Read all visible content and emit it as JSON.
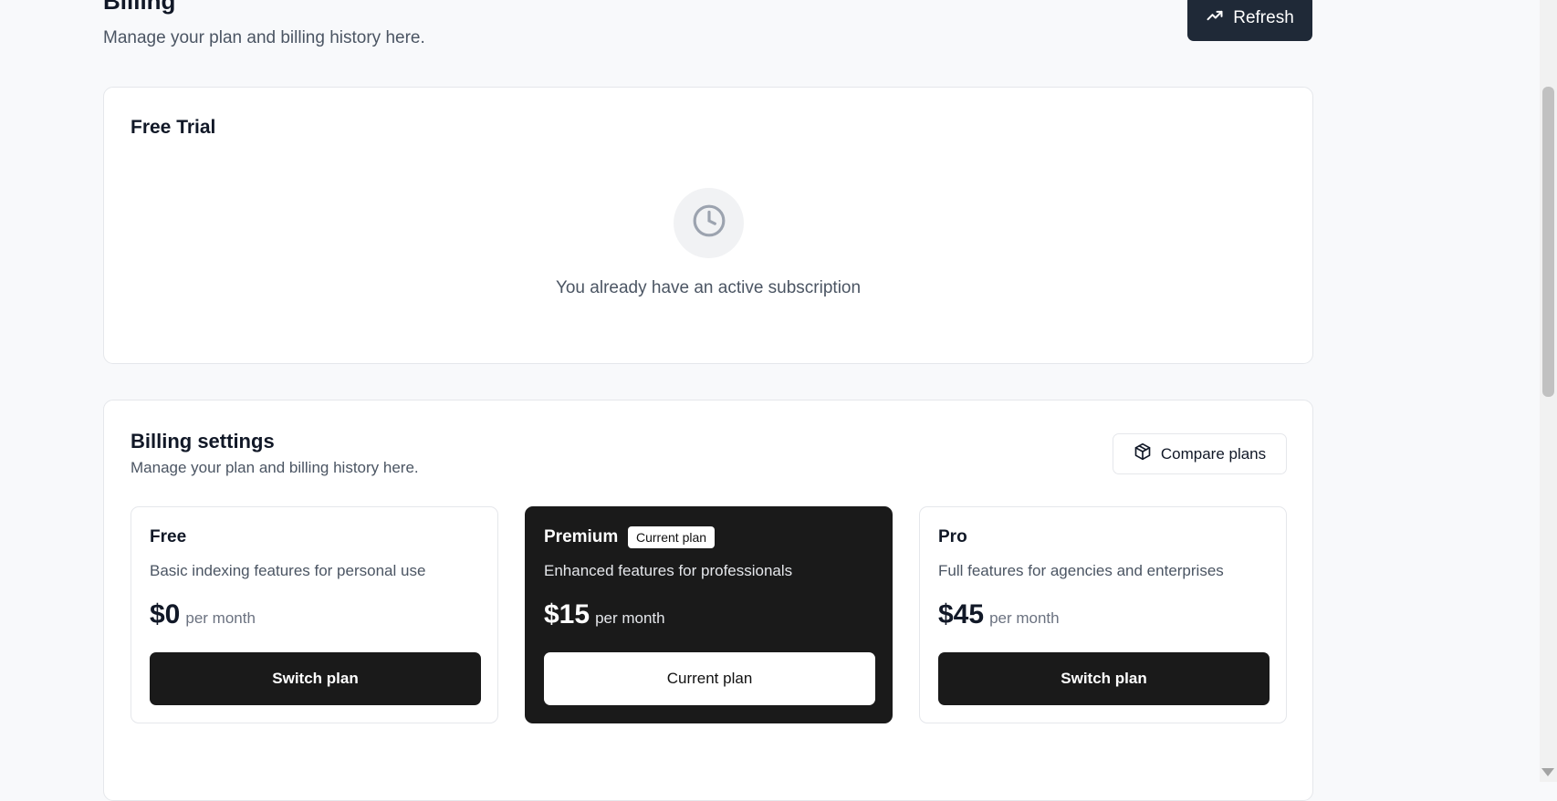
{
  "header": {
    "title": "Billing",
    "subtitle": "Manage your plan and billing history here.",
    "refresh_label": "Refresh"
  },
  "trial": {
    "title": "Free Trial",
    "message": "You already have an active subscription"
  },
  "billing_settings": {
    "title": "Billing settings",
    "subtitle": "Manage your plan and billing history here.",
    "compare_label": "Compare plans",
    "plans": [
      {
        "name": "Free",
        "description": "Basic indexing features for personal use",
        "price": "$0",
        "period": "per month",
        "button": "Switch plan"
      },
      {
        "name": "Premium",
        "badge": "Current plan",
        "description": "Enhanced features for professionals",
        "price": "$15",
        "period": "per month",
        "button": "Current plan"
      },
      {
        "name": "Pro",
        "description": "Full features for agencies and enterprises",
        "price": "$45",
        "period": "per month",
        "button": "Switch plan"
      }
    ]
  },
  "icons": {
    "refresh": "trending-up-icon",
    "trial": "clock-icon",
    "compare": "package-icon"
  },
  "colors": {
    "background": "#f8f9fb",
    "dark": "#1a1a1a",
    "refresh_button": "#1f2937"
  }
}
